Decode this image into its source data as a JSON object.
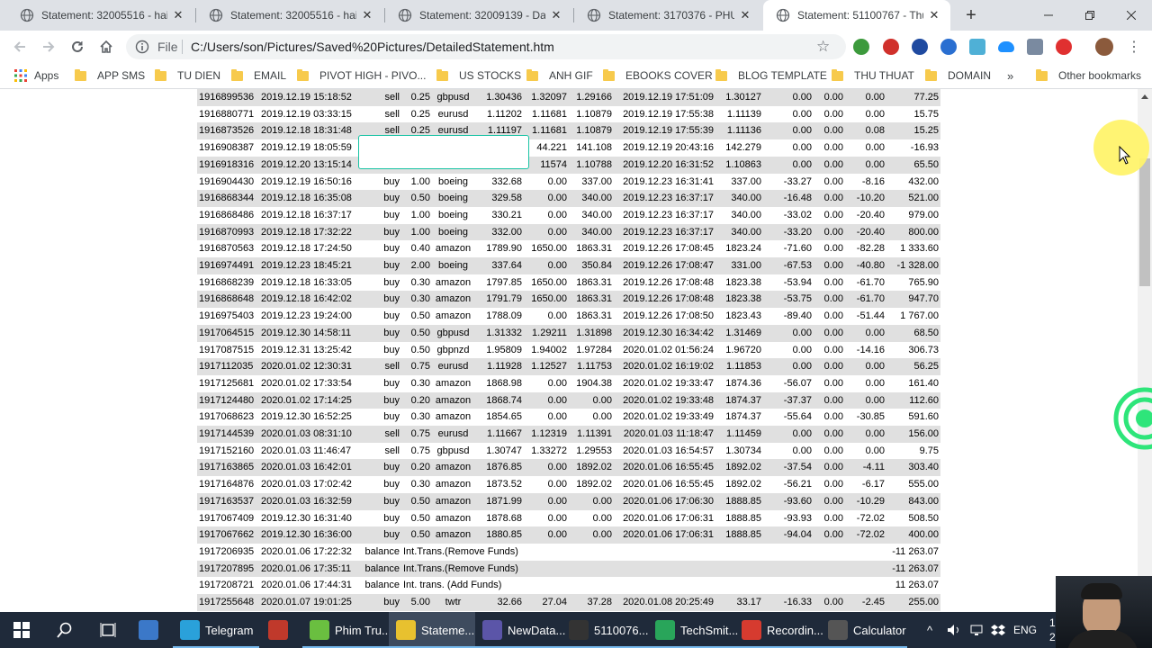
{
  "tabs": [
    {
      "title": "Statement: 32005516 - hai t",
      "active": false
    },
    {
      "title": "Statement: 32005516 - hai t",
      "active": false
    },
    {
      "title": "Statement: 32009139 - Dao",
      "active": false
    },
    {
      "title": "Statement: 3170376 - PHUC",
      "active": false
    },
    {
      "title": "Statement: 51100767 - Thu",
      "active": true
    }
  ],
  "toolbar": {
    "file_label": "File",
    "url": "C:/Users/son/Pictures/Saved%20Pictures/DetailedStatement.htm"
  },
  "bookmarks": {
    "apps_label": "Apps",
    "items": [
      "APP SMS",
      "TU DIEN",
      "EMAIL",
      "PIVOT HIGH - PIVO...",
      "US STOCKS",
      "ANH GIF",
      "EBOOKS COVER",
      "BLOG TEMPLATE",
      "THU THUAT",
      "DOMAIN"
    ],
    "more_label": "»",
    "other_label": "Other bookmarks"
  },
  "statement": {
    "rows": [
      [
        "1916899536",
        "2019.12.19 15:18:52",
        "sell",
        "0.25",
        "gbpusd",
        "1.30436",
        "1.32097",
        "1.29166",
        "2019.12.19 17:51:09",
        "1.30127",
        "0.00",
        "0.00",
        "0.00",
        "77.25"
      ],
      [
        "1916880771",
        "2019.12.19 03:33:15",
        "sell",
        "0.25",
        "eurusd",
        "1.11202",
        "1.11681",
        "1.10879",
        "2019.12.19 17:55:38",
        "1.11139",
        "0.00",
        "0.00",
        "0.00",
        "15.75"
      ],
      [
        "1916873526",
        "2019.12.18 18:31:48",
        "sell",
        "0.25",
        "eurusd",
        "1.11197",
        "1.11681",
        "1.10879",
        "2019.12.19 17:55:39",
        "1.11136",
        "0.00",
        "0.00",
        "0.08",
        "15.25"
      ],
      [
        "1916908387",
        "2019.12.19 18:05:59",
        "",
        "",
        "",
        "",
        "44.221",
        "141.108",
        "2019.12.19 20:43:16",
        "142.279",
        "0.00",
        "0.00",
        "0.00",
        "-16.93"
      ],
      [
        "1916918316",
        "2019.12.20 13:15:14",
        "",
        "",
        "",
        "",
        "11574",
        "1.10788",
        "2019.12.20 16:31:52",
        "1.10863",
        "0.00",
        "0.00",
        "0.00",
        "65.50"
      ],
      [
        "1916904430",
        "2019.12.19 16:50:16",
        "buy",
        "1.00",
        "boeing",
        "332.68",
        "0.00",
        "337.00",
        "2019.12.23 16:31:41",
        "337.00",
        "-33.27",
        "0.00",
        "-8.16",
        "432.00"
      ],
      [
        "1916868344",
        "2019.12.18 16:35:08",
        "buy",
        "0.50",
        "boeing",
        "329.58",
        "0.00",
        "340.00",
        "2019.12.23 16:37:17",
        "340.00",
        "-16.48",
        "0.00",
        "-10.20",
        "521.00"
      ],
      [
        "1916868486",
        "2019.12.18 16:37:17",
        "buy",
        "1.00",
        "boeing",
        "330.21",
        "0.00",
        "340.00",
        "2019.12.23 16:37:17",
        "340.00",
        "-33.02",
        "0.00",
        "-20.40",
        "979.00"
      ],
      [
        "1916870993",
        "2019.12.18 17:32:22",
        "buy",
        "1.00",
        "boeing",
        "332.00",
        "0.00",
        "340.00",
        "2019.12.23 16:37:17",
        "340.00",
        "-33.20",
        "0.00",
        "-20.40",
        "800.00"
      ],
      [
        "1916870563",
        "2019.12.18 17:24:50",
        "buy",
        "0.40",
        "amazon",
        "1789.90",
        "1650.00",
        "1863.31",
        "2019.12.26 17:08:45",
        "1823.24",
        "-71.60",
        "0.00",
        "-82.28",
        "1 333.60"
      ],
      [
        "1916974491",
        "2019.12.23 18:45:21",
        "buy",
        "2.00",
        "boeing",
        "337.64",
        "0.00",
        "350.84",
        "2019.12.26 17:08:47",
        "331.00",
        "-67.53",
        "0.00",
        "-40.80",
        "-1 328.00"
      ],
      [
        "1916868239",
        "2019.12.18 16:33:05",
        "buy",
        "0.30",
        "amazon",
        "1797.85",
        "1650.00",
        "1863.31",
        "2019.12.26 17:08:48",
        "1823.38",
        "-53.94",
        "0.00",
        "-61.70",
        "765.90"
      ],
      [
        "1916868648",
        "2019.12.18 16:42:02",
        "buy",
        "0.30",
        "amazon",
        "1791.79",
        "1650.00",
        "1863.31",
        "2019.12.26 17:08:48",
        "1823.38",
        "-53.75",
        "0.00",
        "-61.70",
        "947.70"
      ],
      [
        "1916975403",
        "2019.12.23 19:24:00",
        "buy",
        "0.50",
        "amazon",
        "1788.09",
        "0.00",
        "1863.31",
        "2019.12.26 17:08:50",
        "1823.43",
        "-89.40",
        "0.00",
        "-51.44",
        "1 767.00"
      ],
      [
        "1917064515",
        "2019.12.30 14:58:11",
        "buy",
        "0.50",
        "gbpusd",
        "1.31332",
        "1.29211",
        "1.31898",
        "2019.12.30 16:34:42",
        "1.31469",
        "0.00",
        "0.00",
        "0.00",
        "68.50"
      ],
      [
        "1917087515",
        "2019.12.31 13:25:42",
        "buy",
        "0.50",
        "gbpnzd",
        "1.95809",
        "1.94002",
        "1.97284",
        "2020.01.02 01:56:24",
        "1.96720",
        "0.00",
        "0.00",
        "-14.16",
        "306.73"
      ],
      [
        "1917112035",
        "2020.01.02 12:30:31",
        "sell",
        "0.75",
        "eurusd",
        "1.11928",
        "1.12527",
        "1.11753",
        "2020.01.02 16:19:02",
        "1.11853",
        "0.00",
        "0.00",
        "0.00",
        "56.25"
      ],
      [
        "1917125681",
        "2020.01.02 17:33:54",
        "buy",
        "0.30",
        "amazon",
        "1868.98",
        "0.00",
        "1904.38",
        "2020.01.02 19:33:47",
        "1874.36",
        "-56.07",
        "0.00",
        "0.00",
        "161.40"
      ],
      [
        "1917124480",
        "2020.01.02 17:14:25",
        "buy",
        "0.20",
        "amazon",
        "1868.74",
        "0.00",
        "0.00",
        "2020.01.02 19:33:48",
        "1874.37",
        "-37.37",
        "0.00",
        "0.00",
        "112.60"
      ],
      [
        "1917068623",
        "2019.12.30 16:52:25",
        "buy",
        "0.30",
        "amazon",
        "1854.65",
        "0.00",
        "0.00",
        "2020.01.02 19:33:49",
        "1874.37",
        "-55.64",
        "0.00",
        "-30.85",
        "591.60"
      ],
      [
        "1917144539",
        "2020.01.03 08:31:10",
        "sell",
        "0.75",
        "eurusd",
        "1.11667",
        "1.12319",
        "1.11391",
        "2020.01.03 11:18:47",
        "1.11459",
        "0.00",
        "0.00",
        "0.00",
        "156.00"
      ],
      [
        "1917152160",
        "2020.01.03 11:46:47",
        "sell",
        "0.75",
        "gbpusd",
        "1.30747",
        "1.33272",
        "1.29553",
        "2020.01.03 16:54:57",
        "1.30734",
        "0.00",
        "0.00",
        "0.00",
        "9.75"
      ],
      [
        "1917163865",
        "2020.01.03 16:42:01",
        "buy",
        "0.20",
        "amazon",
        "1876.85",
        "0.00",
        "1892.02",
        "2020.01.06 16:55:45",
        "1892.02",
        "-37.54",
        "0.00",
        "-4.11",
        "303.40"
      ],
      [
        "1917164876",
        "2020.01.03 17:02:42",
        "buy",
        "0.30",
        "amazon",
        "1873.52",
        "0.00",
        "1892.02",
        "2020.01.06 16:55:45",
        "1892.02",
        "-56.21",
        "0.00",
        "-6.17",
        "555.00"
      ],
      [
        "1917163537",
        "2020.01.03 16:32:59",
        "buy",
        "0.50",
        "amazon",
        "1871.99",
        "0.00",
        "0.00",
        "2020.01.06 17:06:30",
        "1888.85",
        "-93.60",
        "0.00",
        "-10.29",
        "843.00"
      ],
      [
        "1917067409",
        "2019.12.30 16:31:40",
        "buy",
        "0.50",
        "amazon",
        "1878.68",
        "0.00",
        "0.00",
        "2020.01.06 17:06:31",
        "1888.85",
        "-93.93",
        "0.00",
        "-72.02",
        "508.50"
      ],
      [
        "1917067662",
        "2019.12.30 16:36:00",
        "buy",
        "0.50",
        "amazon",
        "1880.85",
        "0.00",
        "0.00",
        "2020.01.06 17:06:31",
        "1888.85",
        "-94.04",
        "0.00",
        "-72.02",
        "400.00"
      ],
      {
        "ticket": "1917206935",
        "time": "2020.01.06 17:22:32",
        "type": "balance",
        "comment": "Int.Trans.(Remove Funds)",
        "profit": "-11 263.07"
      },
      {
        "ticket": "1917207895",
        "time": "2020.01.06 17:35:11",
        "type": "balance",
        "comment": "Int.Trans.(Remove Funds)",
        "profit": "-11 263.07"
      },
      {
        "ticket": "1917208721",
        "time": "2020.01.06 17:44:31",
        "type": "balance",
        "comment": "Int. trans. (Add Funds)",
        "profit": "11 263.07"
      },
      [
        "1917255648",
        "2020.01.07 19:01:25",
        "buy",
        "5.00",
        "twtr",
        "32.66",
        "27.04",
        "37.28",
        "2020.01.08 20:25:49",
        "33.17",
        "-16.33",
        "0.00",
        "-2.45",
        "255.00"
      ]
    ]
  },
  "taskbar": {
    "items": [
      {
        "label": "",
        "icon": "windows-start-icon"
      },
      {
        "label": "",
        "icon": "search-icon"
      },
      {
        "label": "",
        "icon": "task-view-icon"
      },
      {
        "label": "",
        "icon": "file-explorer-icon"
      },
      {
        "label": "Telegram",
        "icon": "telegram-icon"
      },
      {
        "label": "",
        "icon": "recorder-icon"
      },
      {
        "label": "Phim Tru...",
        "icon": "phim-icon"
      },
      {
        "label": "Stateme...",
        "icon": "chrome-icon"
      },
      {
        "label": "NewData...",
        "icon": "newdata-icon"
      },
      {
        "label": "5110076...",
        "icon": "terminal-icon"
      },
      {
        "label": "TechSmit...",
        "icon": "camtasia-icon"
      },
      {
        "label": "Recordin...",
        "icon": "recording-icon"
      },
      {
        "label": "Calculator",
        "icon": "calculator-icon"
      }
    ],
    "lang": "ENG",
    "clock_partial": [
      "1",
      "2"
    ]
  },
  "colors": {
    "row_shaded": "#e0e0e0",
    "selection_border": "#18c3a4",
    "taskbar_bg": "#1f2a3a",
    "cursor_highlight": "#fff36b"
  }
}
